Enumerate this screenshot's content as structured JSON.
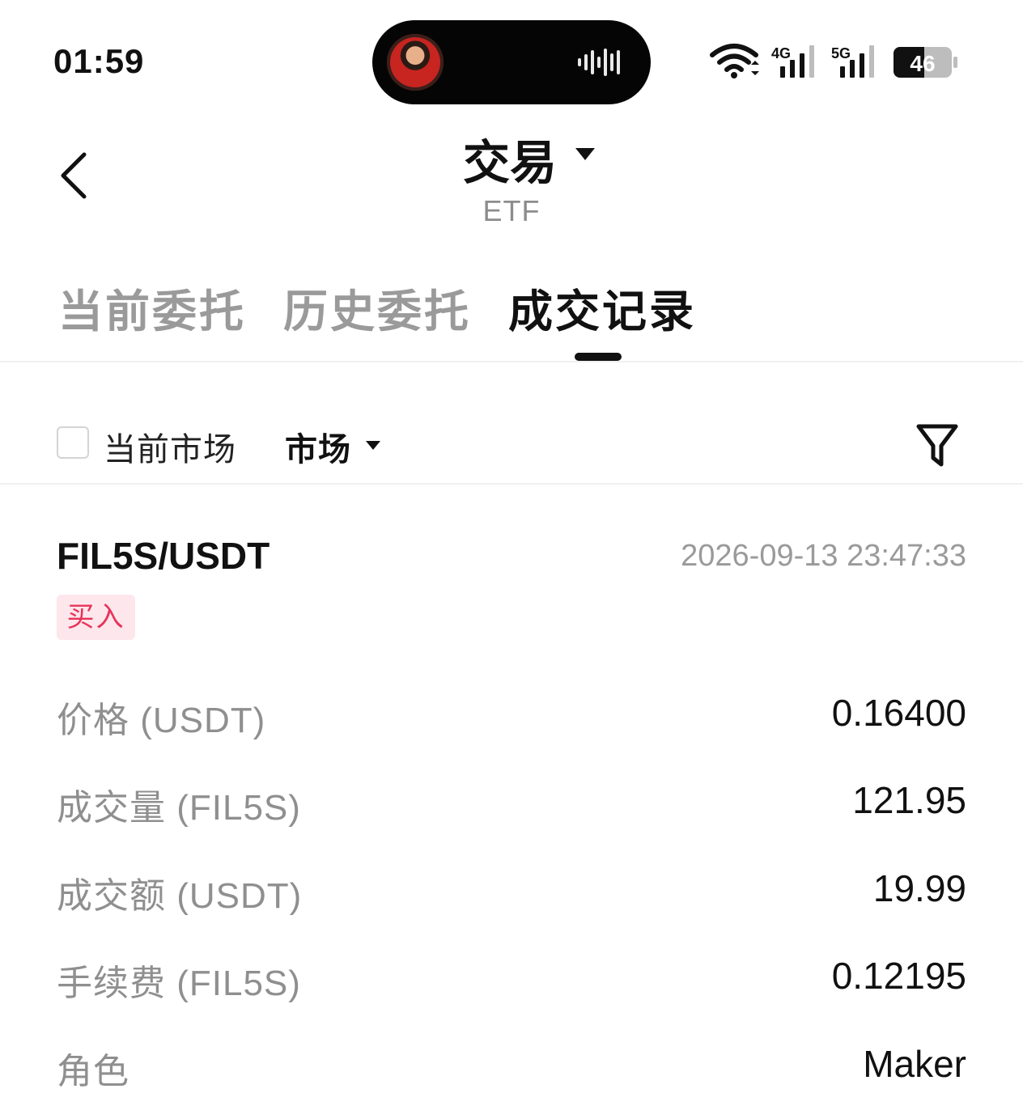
{
  "status_bar": {
    "time": "01:59",
    "network_4g": "4G",
    "network_5g": "5G",
    "battery": "46"
  },
  "header": {
    "title": "交易",
    "subtitle": "ETF"
  },
  "tabs": [
    {
      "label": "当前委托",
      "active": false
    },
    {
      "label": "历史委托",
      "active": false
    },
    {
      "label": "成交记录",
      "active": true
    }
  ],
  "filters": {
    "current_market_label": "当前市场",
    "current_market_checked": false,
    "market_dropdown_label": "市场"
  },
  "record": {
    "pair": "FIL5S/USDT",
    "datetime": "2026-09-13 23:47:33",
    "side": "买入",
    "fields": [
      {
        "label": "价格 (USDT)",
        "value": "0.16400"
      },
      {
        "label": "成交量 (FIL5S)",
        "value": "121.95"
      },
      {
        "label": "成交额 (USDT)",
        "value": "19.99"
      },
      {
        "label": "手续费 (FIL5S)",
        "value": "0.12195"
      },
      {
        "label": "角色",
        "value": "Maker"
      }
    ]
  },
  "colors": {
    "buy_text": "#e8335a",
    "buy_bg": "#fde7ec",
    "muted": "#8f8f8f"
  }
}
